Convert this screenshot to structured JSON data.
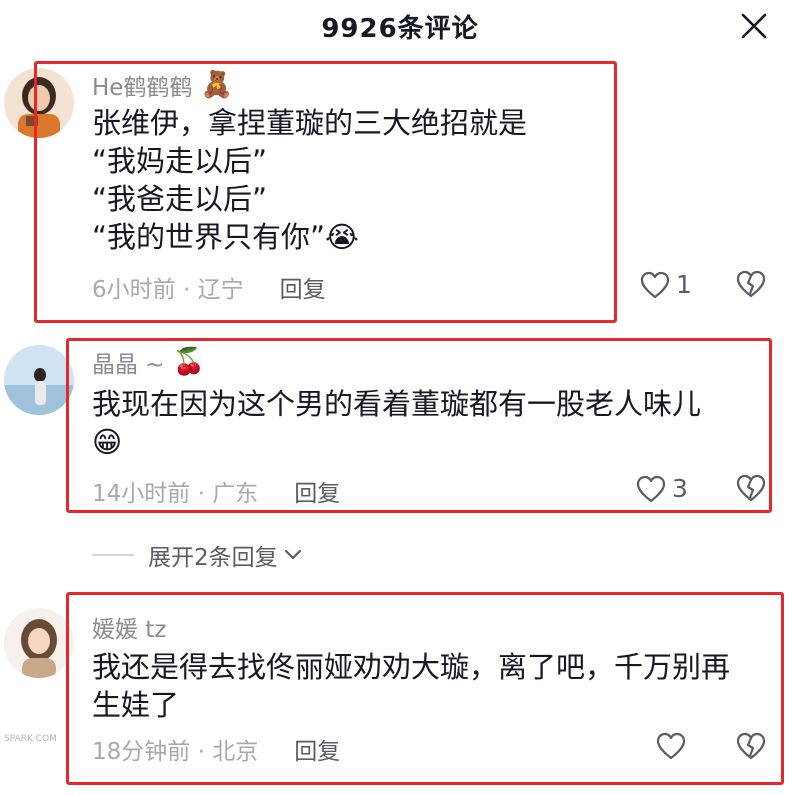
{
  "header": {
    "title": "9926条评论",
    "close_icon": "close-icon"
  },
  "comments": [
    {
      "username": "He鹤鹤鹤",
      "name_emoji": "🧸",
      "lines": [
        "张维伊，拿捏董璇的三大绝招就是",
        "“我妈走以后”",
        "“我爸走以后”",
        "“我的世界只有你”😭"
      ],
      "time": "6小时前 · 辽宁",
      "reply_label": "回复",
      "likes": "1"
    },
    {
      "username": "晶晶 ~",
      "name_emoji": "🍒",
      "lines": [
        "我现在因为这个男的看着董璇都有一股老人味儿",
        "😁"
      ],
      "time": "14小时前 · 广东",
      "reply_label": "回复",
      "likes": "3"
    },
    {
      "username": "媛媛 tz",
      "name_emoji": "",
      "lines": [
        "我还是得去找佟丽娅劝劝大璇，离了吧，千万别再",
        "生娃了"
      ],
      "time": "18分钟前 · 北京",
      "reply_label": "回复",
      "likes": ""
    }
  ],
  "expand_replies": "展开2条回复",
  "watermark": "SPARK·COM",
  "colors": {
    "highlight_box": "#e8262c",
    "secondary_text": "#8a8b91",
    "primary_text": "#161823"
  }
}
